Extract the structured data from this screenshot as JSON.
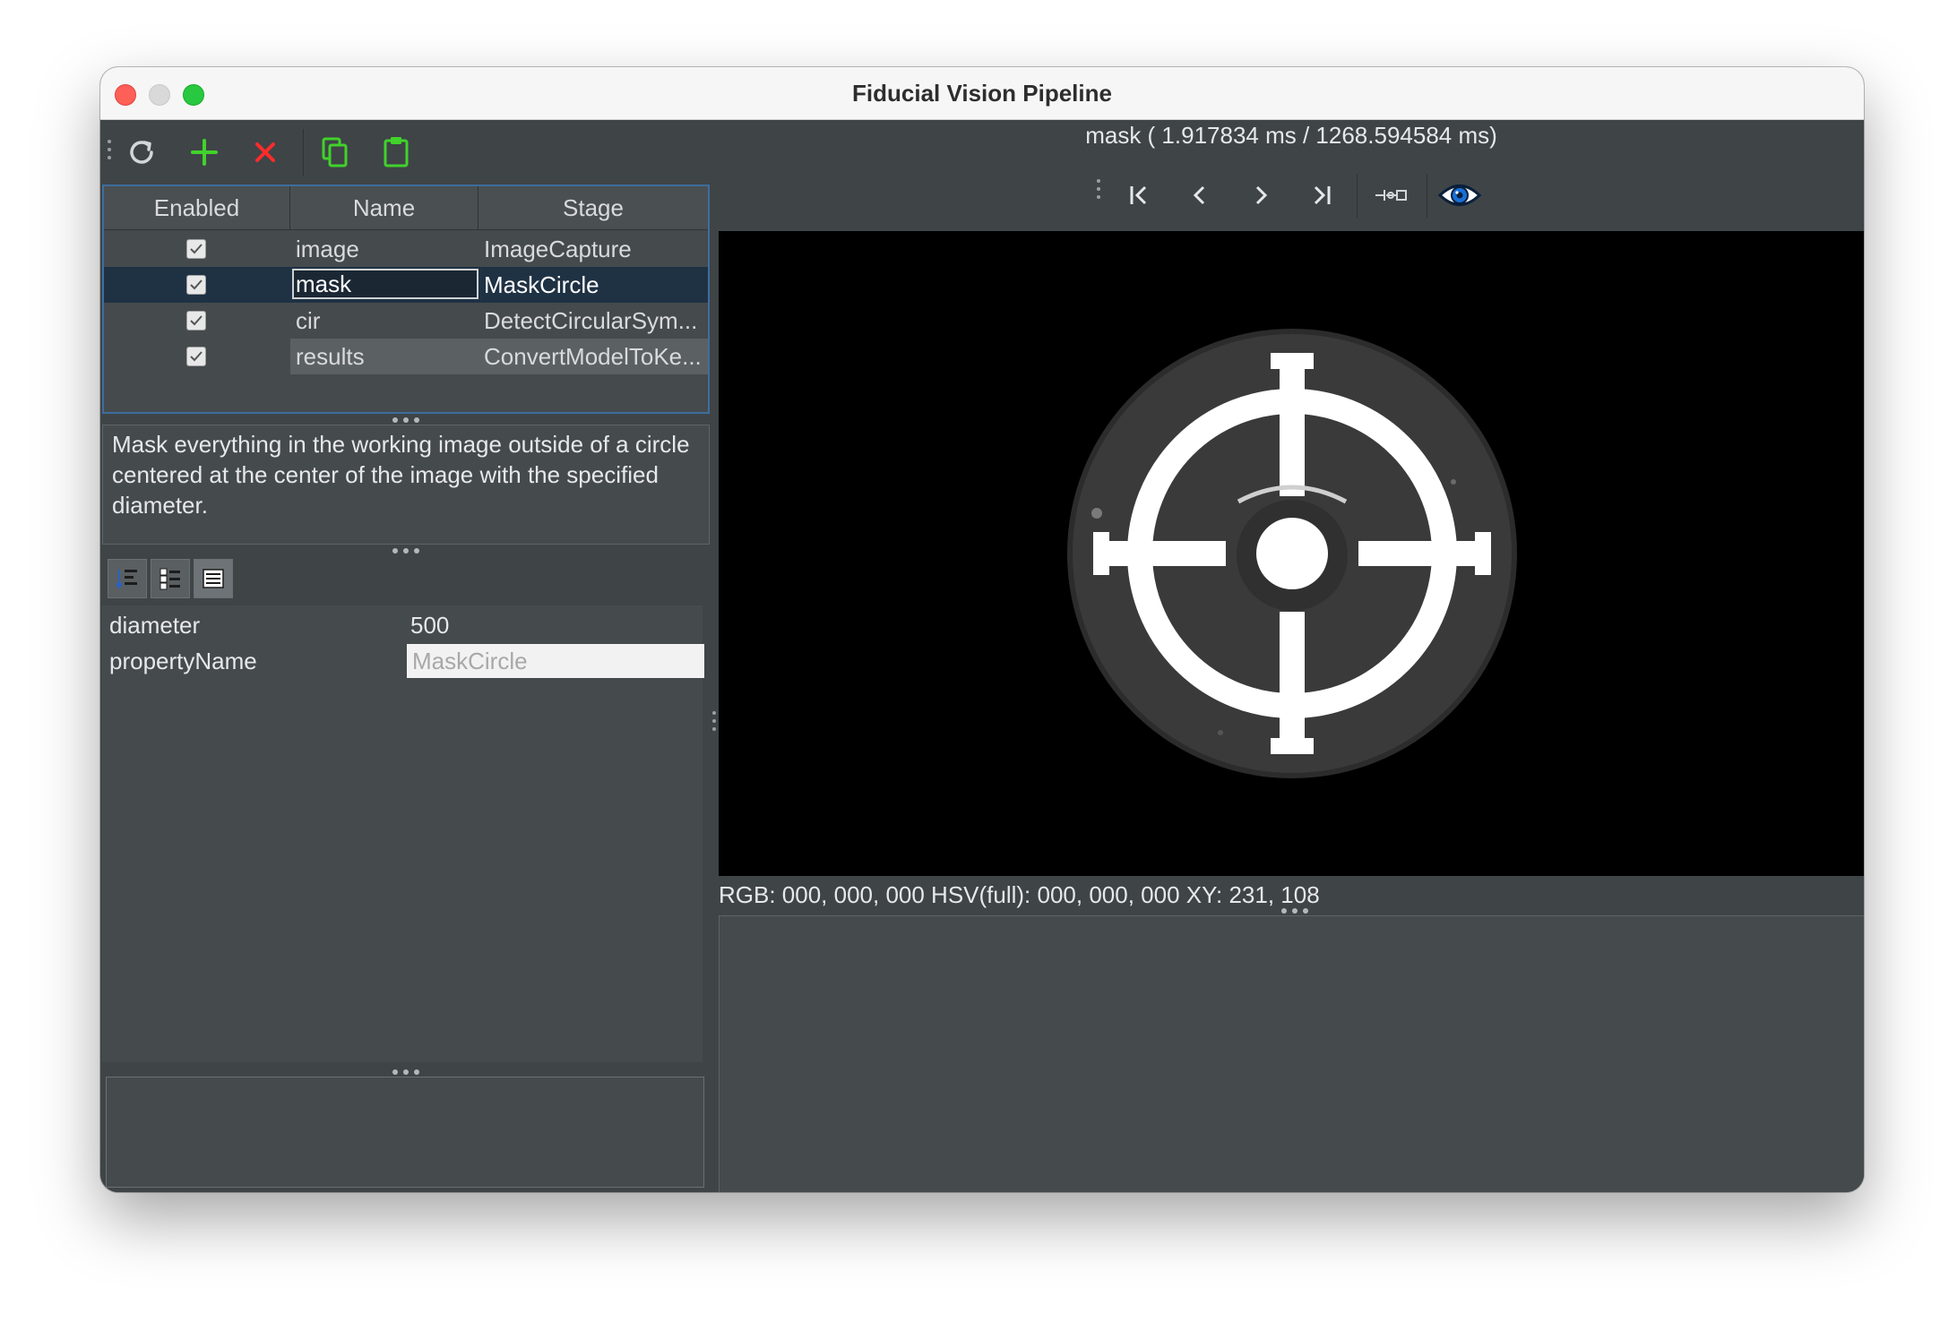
{
  "window": {
    "title": "Fiducial Vision Pipeline"
  },
  "toolbar": {
    "buttons": [
      {
        "icon": "refresh-icon"
      },
      {
        "icon": "add-icon",
        "color": "#41d22b"
      },
      {
        "icon": "delete-icon",
        "color": "#ff2b2b"
      },
      {
        "icon": "copy-icon",
        "color": "#41d22b"
      },
      {
        "icon": "paste-icon",
        "color": "#41d22b"
      }
    ]
  },
  "stages_table": {
    "columns": [
      "Enabled",
      "Name",
      "Stage"
    ],
    "rows": [
      {
        "enabled": true,
        "name": "image",
        "stage": "ImageCapture"
      },
      {
        "enabled": true,
        "name": "mask",
        "stage": "MaskCircle",
        "selected": true,
        "editing": true
      },
      {
        "enabled": true,
        "name": "cir",
        "stage": "DetectCircularSym..."
      },
      {
        "enabled": true,
        "name": "results",
        "stage": "ConvertModelToKe...",
        "highlighted": true
      }
    ]
  },
  "description": "Mask everything in the working image outside of a circle centered at the center of the image with the specified diameter.",
  "properties": [
    {
      "name": "diameter",
      "value": "500"
    },
    {
      "name": "propertyName",
      "value": "MaskCircle",
      "readonly": true
    }
  ],
  "viewer": {
    "timing": "mask ( 1.917834 ms / 1268.594584 ms)",
    "nav_buttons": [
      "first-icon",
      "prev-icon",
      "next-icon",
      "last-icon",
      "link-icon",
      "eye-icon"
    ],
    "readout": "RGB: 000, 000, 000 HSV(full): 000, 000, 000 XY: 231, 108"
  },
  "colors": {
    "selection": "#1f3244",
    "accent_green": "#41d22b",
    "accent_red": "#ff2b2b",
    "eye_blue": "#1a6fd6"
  }
}
